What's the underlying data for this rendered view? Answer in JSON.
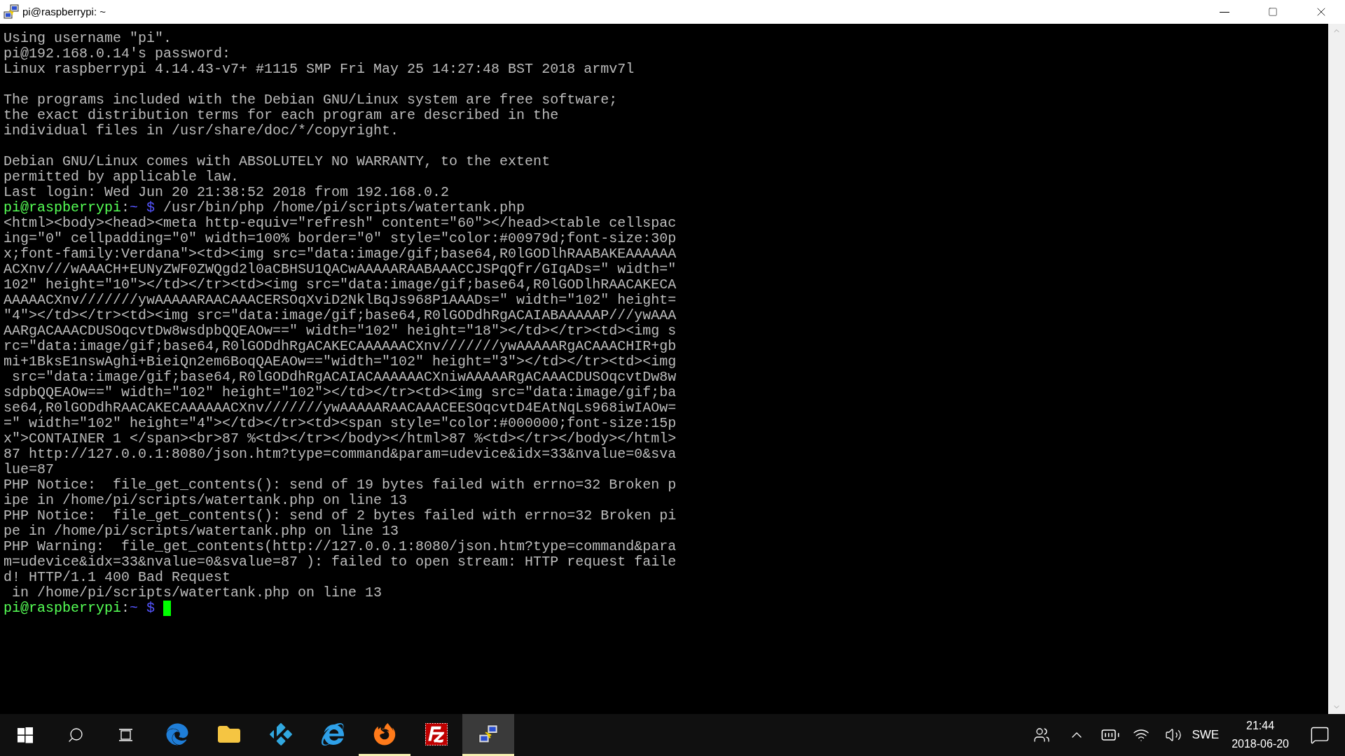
{
  "window": {
    "title": "pi@raspberrypi: ~"
  },
  "terminal": {
    "lines": [
      {
        "kind": "plain",
        "text": "Using username \"pi\"."
      },
      {
        "kind": "plain",
        "text": "pi@192.168.0.14's password:"
      },
      {
        "kind": "plain",
        "text": "Linux raspberrypi 4.14.43-v7+ #1115 SMP Fri May 25 14:27:48 BST 2018 armv7l"
      },
      {
        "kind": "blank"
      },
      {
        "kind": "plain",
        "text": "The programs included with the Debian GNU/Linux system are free software;"
      },
      {
        "kind": "plain",
        "text": "the exact distribution terms for each program are described in the"
      },
      {
        "kind": "plain",
        "text": "individual files in /usr/share/doc/*/copyright."
      },
      {
        "kind": "blank"
      },
      {
        "kind": "plain",
        "text": "Debian GNU/Linux comes with ABSOLUTELY NO WARRANTY, to the extent"
      },
      {
        "kind": "plain",
        "text": "permitted by applicable law."
      },
      {
        "kind": "plain",
        "text": "Last login: Wed Jun 20 21:38:52 2018 from 192.168.0.2"
      },
      {
        "kind": "prompt",
        "user_host": "pi@raspberrypi",
        "separator": ":",
        "path": "~",
        "symbol": "$",
        "command": "/usr/bin/php /home/pi/scripts/watertank.php"
      },
      {
        "kind": "plain",
        "text": "<html><body><head><meta http-equiv=\"refresh\" content=\"60\"></head><table cellspac"
      },
      {
        "kind": "plain",
        "text": "ing=\"0\" cellpadding=\"0\" width=100% border=\"0\" style=\"color:#00979d;font-size:30p"
      },
      {
        "kind": "plain",
        "text": "x;font-family:Verdana\"><td><img src=\"data:image/gif;base64,R0lGODlhRAABAKEAAAAAA"
      },
      {
        "kind": "plain",
        "text": "ACXnv///wAAACH+EUNyZWF0ZWQgd2l0aCBHSU1QACwAAAAARAABAAACCJSPqQfr/GIqADs=\" width=\""
      },
      {
        "kind": "plain",
        "text": "102\" height=\"10\"></td></tr><td><img src=\"data:image/gif;base64,R0lGODlhRAACAKECA"
      },
      {
        "kind": "plain",
        "text": "AAAAACXnv///////ywAAAAARAACAAACERSOqXviD2NklBqJs968P1AAADs=\" width=\"102\" height="
      },
      {
        "kind": "plain",
        "text": "\"4\"></td></tr><td><img src=\"data:image/gif;base64,R0lGODdhRgACAIABAAAAAP///ywAAA"
      },
      {
        "kind": "plain",
        "text": "AARgACAAACDUSOqcvtDw8wsdpbQQEAOw==\" width=\"102\" height=\"18\"></td></tr><td><img s"
      },
      {
        "kind": "plain",
        "text": "rc=\"data:image/gif;base64,R0lGODdhRgACAKECAAAAAACXnv///////ywAAAAARgACAAACHIR+gb"
      },
      {
        "kind": "plain",
        "text": "mi+1BksE1nswAghi+BieiQn2em6BoqQAEAOw==\"width=\"102\" height=\"3\"></td></tr><td><img"
      },
      {
        "kind": "plain",
        "text": " src=\"data:image/gif;base64,R0lGODdhRgACAIACAAAAAACXniwAAAAARgACAAACDUSOqcvtDw8w"
      },
      {
        "kind": "plain",
        "text": "sdpbQQEAOw==\" width=\"102\" height=\"102\"></td></tr><td><img src=\"data:image/gif;ba"
      },
      {
        "kind": "plain",
        "text": "se64,R0lGODdhRAACAKECAAAAAACXnv///////ywAAAAARAACAAACEESOqcvtD4EAtNqLs968iwIAOw="
      },
      {
        "kind": "plain",
        "text": "=\" width=\"102\" height=\"4\"></td></tr><td><span style=\"color:#000000;font-size:15p"
      },
      {
        "kind": "plain",
        "text": "x\">CONTAINER 1 </span><br>87 %<td></tr></body></html>87 %<td></tr></body></html>"
      },
      {
        "kind": "plain",
        "text": "87 http://127.0.0.1:8080/json.htm?type=command&param=udevice&idx=33&nvalue=0&sva"
      },
      {
        "kind": "plain",
        "text": "lue=87"
      },
      {
        "kind": "plain",
        "text": "PHP Notice:  file_get_contents(): send of 19 bytes failed with errno=32 Broken p"
      },
      {
        "kind": "plain",
        "text": "ipe in /home/pi/scripts/watertank.php on line 13"
      },
      {
        "kind": "plain",
        "text": "PHP Notice:  file_get_contents(): send of 2 bytes failed with errno=32 Broken pi"
      },
      {
        "kind": "plain",
        "text": "pe in /home/pi/scripts/watertank.php on line 13"
      },
      {
        "kind": "plain",
        "text": "PHP Warning:  file_get_contents(http://127.0.0.1:8080/json.htm?type=command&para"
      },
      {
        "kind": "plain",
        "text": "m=udevice&idx=33&nvalue=0&svalue=87 ): failed to open stream: HTTP request faile"
      },
      {
        "kind": "plain",
        "text": "d! HTTP/1.1 400 Bad Request"
      },
      {
        "kind": "plain",
        "text": " in /home/pi/scripts/watertank.php on line 13"
      },
      {
        "kind": "prompt",
        "user_host": "pi@raspberrypi",
        "separator": ":",
        "path": "~",
        "symbol": "$",
        "cursor": true
      }
    ]
  },
  "taskbar": {
    "apps": [
      {
        "kind": "edge",
        "running": false,
        "selected": false
      },
      {
        "kind": "explorer",
        "running": false,
        "selected": false
      },
      {
        "kind": "kodi",
        "running": false,
        "selected": false
      },
      {
        "kind": "ie",
        "running": false,
        "selected": false
      },
      {
        "kind": "firefox",
        "running": true,
        "selected": false
      },
      {
        "kind": "filezilla",
        "running": false,
        "selected": false
      },
      {
        "kind": "putty",
        "running": true,
        "selected": true
      }
    ],
    "language": "SWE",
    "time": "21:44",
    "date": "2018-06-20"
  }
}
